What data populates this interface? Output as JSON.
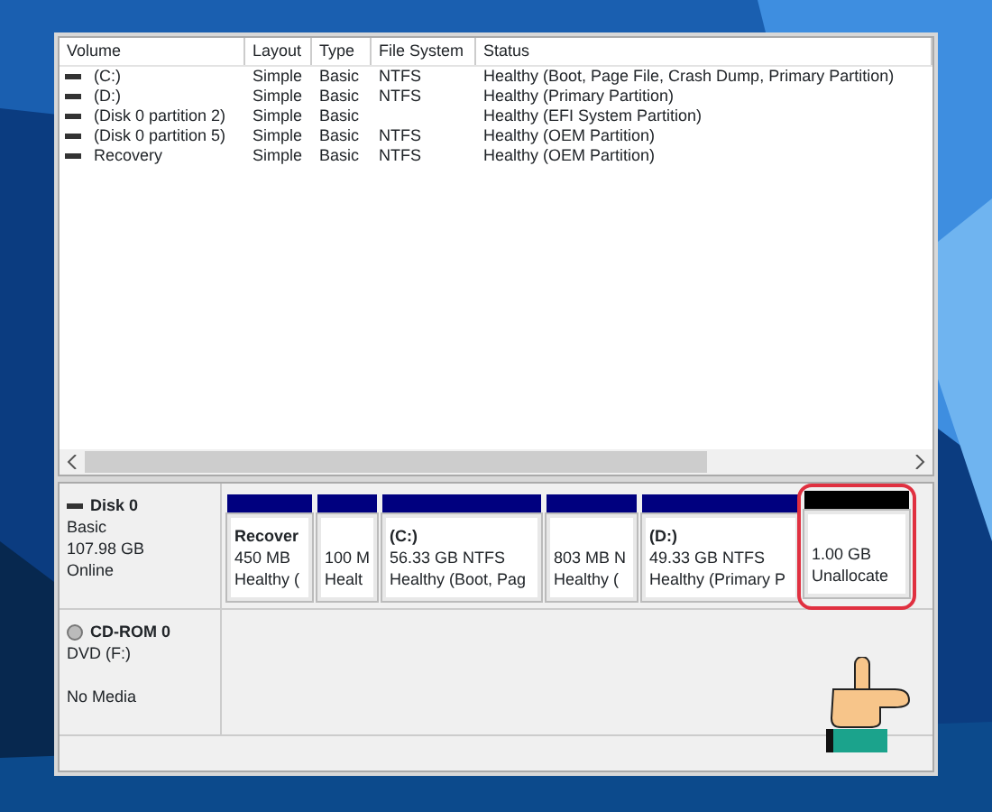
{
  "volumes": {
    "columns": [
      "Volume",
      "Layout",
      "Type",
      "File System",
      "Status"
    ],
    "rows": [
      {
        "cells": [
          "(C:)",
          "Simple",
          "Basic",
          "NTFS",
          "Healthy (Boot, Page File, Crash Dump, Primary Partition)"
        ]
      },
      {
        "cells": [
          "(D:)",
          "Simple",
          "Basic",
          "NTFS",
          "Healthy (Primary Partition)"
        ]
      },
      {
        "cells": [
          "(Disk 0 partition 2)",
          "Simple",
          "Basic",
          "",
          "Healthy (EFI System Partition)"
        ]
      },
      {
        "cells": [
          "(Disk 0 partition 5)",
          "Simple",
          "Basic",
          "NTFS",
          "Healthy (OEM Partition)"
        ]
      },
      {
        "cells": [
          "Recovery",
          "Simple",
          "Basic",
          "NTFS",
          "Healthy (OEM Partition)"
        ]
      }
    ]
  },
  "disks": [
    {
      "kind": "disk",
      "name": "Disk 0",
      "lines": [
        "Basic",
        "107.98 GB",
        "Online"
      ],
      "partitions": [
        {
          "kind": "primary",
          "lines": [
            "Recover",
            "450 MB",
            "Healthy ("
          ],
          "selected": false
        },
        {
          "kind": "primary",
          "lines": [
            "100 M",
            "Healt"
          ],
          "selected": false
        },
        {
          "kind": "primary",
          "lines": [
            "(C:)",
            "56.33 GB NTFS",
            "Healthy (Boot, Pag"
          ],
          "selected": false
        },
        {
          "kind": "primary",
          "lines": [
            "803 MB N",
            "Healthy ("
          ],
          "selected": false
        },
        {
          "kind": "primary",
          "lines": [
            "(D:)",
            "49.33 GB NTFS",
            "Healthy (Primary P"
          ],
          "selected": false
        },
        {
          "kind": "unallocated",
          "lines": [
            "1.00 GB",
            "Unallocate"
          ],
          "selected": true
        }
      ]
    },
    {
      "kind": "cdrom",
      "name": "CD-ROM 0",
      "lines": [
        "DVD (F:)",
        "No Media"
      ]
    }
  ]
}
